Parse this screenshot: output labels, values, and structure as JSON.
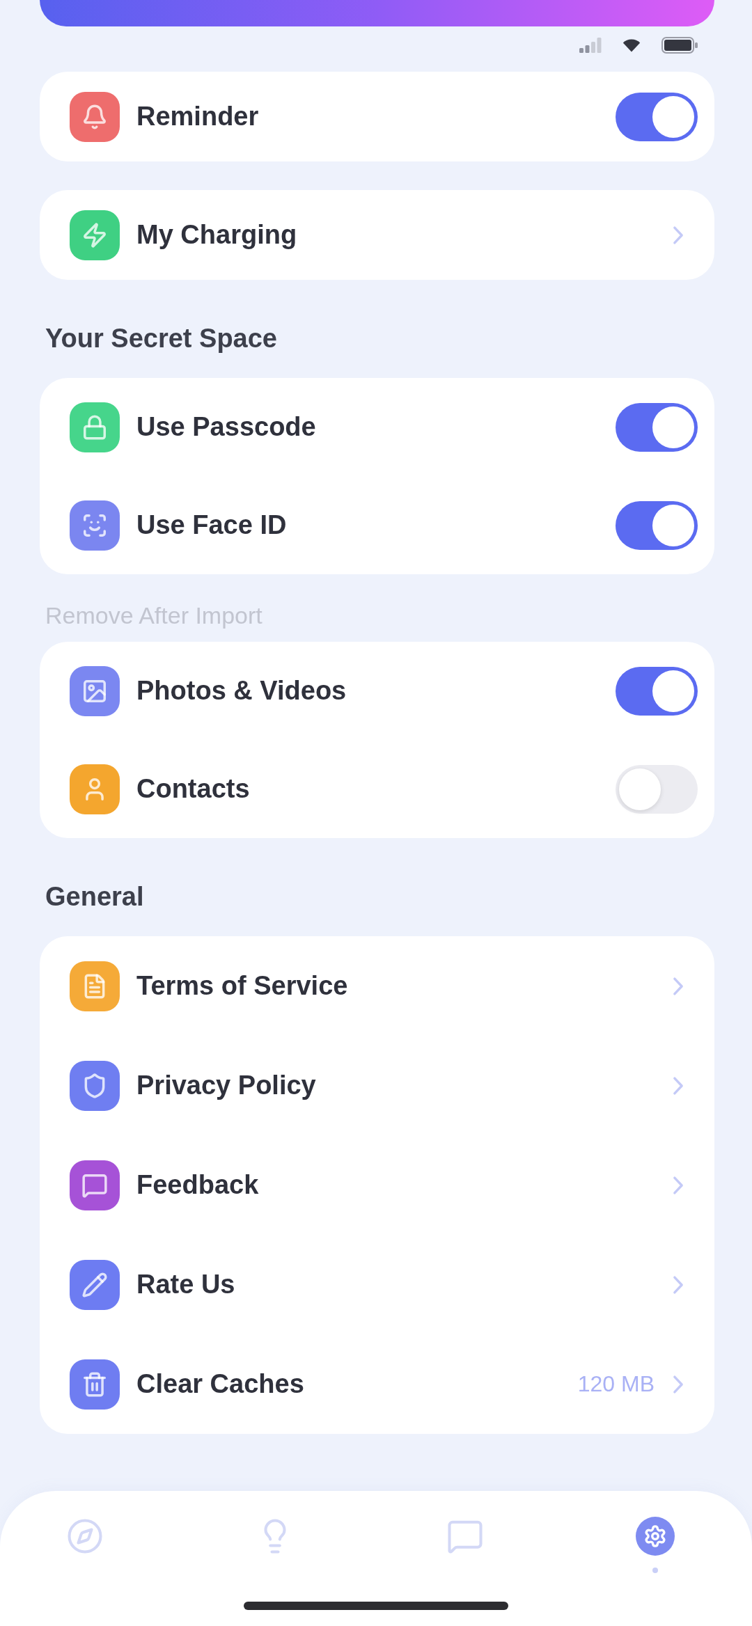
{
  "sections": [
    {
      "items": [
        {
          "kind": "toggle",
          "label": "Reminder",
          "color": "#ee6d6d",
          "on": true
        }
      ]
    },
    {
      "items": [
        {
          "kind": "link",
          "label": "My Charging",
          "color": "#3fd083"
        }
      ]
    },
    {
      "heading": {
        "text": "Your Secret Space",
        "kind": "primary"
      },
      "items": [
        {
          "kind": "toggle",
          "label": "Use Passcode",
          "color": "#46d58b",
          "on": true
        },
        {
          "kind": "toggle",
          "label": "Use Face ID",
          "color": "#7b86f0",
          "on": true
        }
      ]
    },
    {
      "heading": {
        "text": "Remove After Import",
        "kind": "secondary"
      },
      "items": [
        {
          "kind": "toggle",
          "label": "Photos & Videos",
          "color": "#7b87f1",
          "on": true
        },
        {
          "kind": "toggle",
          "label": "Contacts",
          "color": "#f4a62e",
          "on": false
        }
      ]
    },
    {
      "heading": {
        "text": "General",
        "kind": "primary"
      },
      "items": [
        {
          "kind": "link",
          "label": "Terms of Service",
          "color": "#f5aa38"
        },
        {
          "kind": "link",
          "label": "Privacy Policy",
          "color": "#6f7ef1"
        },
        {
          "kind": "link",
          "label": "Feedback",
          "color": "#a652d7"
        },
        {
          "kind": "link",
          "label": "Rate Us",
          "color": "#6d7cf2"
        },
        {
          "kind": "link",
          "label": "Clear Caches",
          "color": "#6f7df1",
          "value": "120 MB"
        }
      ]
    }
  ],
  "tab_bar": {
    "tabs": [
      {
        "selected": false
      },
      {
        "selected": false
      },
      {
        "selected": false
      },
      {
        "selected": true
      }
    ]
  }
}
